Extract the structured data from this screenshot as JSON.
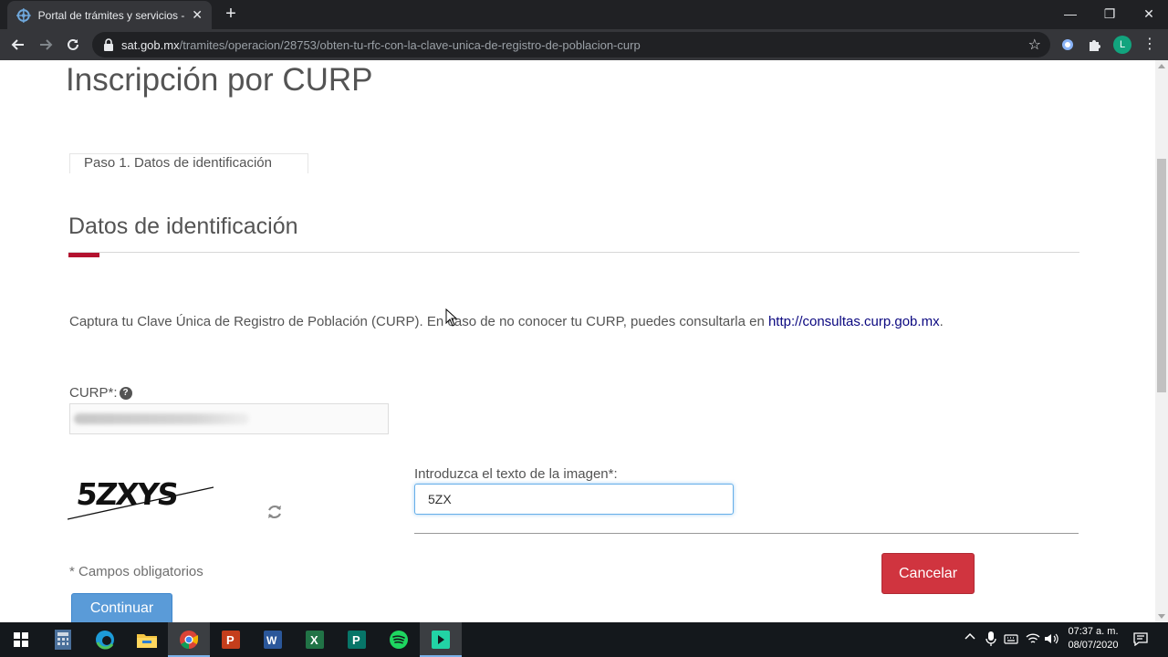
{
  "browser": {
    "tab_title": "Portal de trámites y servicios - SAT",
    "tab_close": "✕",
    "new_tab": "+",
    "url_host": "sat.gob.mx",
    "url_path": "/tramites/operacion/28753/obten-tu-rfc-con-la-clave-unica-de-registro-de-poblacion-curp",
    "profile_initial": "L",
    "window_controls": {
      "minimize": "—",
      "restore": "❐",
      "close": "✕"
    }
  },
  "page": {
    "title": "Inscripción por CURP",
    "step_tab": "Paso 1. Datos de identificación",
    "section_title": "Datos de identificación",
    "intro_text": "Captura tu Clave Única de Registro de Población (CURP). En caso de no conocer tu CURP, puedes consultarla en ",
    "intro_link": "http://consultas.curp.gob.mx",
    "intro_end": ".",
    "curp_label": "CURP*:",
    "help_glyph": "?",
    "captcha_text": "5ZXYS",
    "captcha_label": "Introduzca el texto de la imagen*:",
    "captcha_value": "5ZX",
    "required_note": "* Campos obligatorios",
    "cancel_label": "Cancelar",
    "continue_label": "Continuar"
  },
  "taskbar": {
    "apps": [
      "calculator-icon",
      "edge-icon",
      "file-explorer-icon",
      "chrome-icon",
      "powerpoint-icon",
      "word-icon",
      "excel-icon",
      "publisher-icon",
      "spotify-icon",
      "app-icon"
    ],
    "time": "07:37 a. m.",
    "date": "08/07/2020"
  },
  "colors": {
    "accent_red": "#b3122f",
    "cancel_red": "#d0343f",
    "continue_blue": "#5a9bd8",
    "link_blue": "#0b0880"
  }
}
